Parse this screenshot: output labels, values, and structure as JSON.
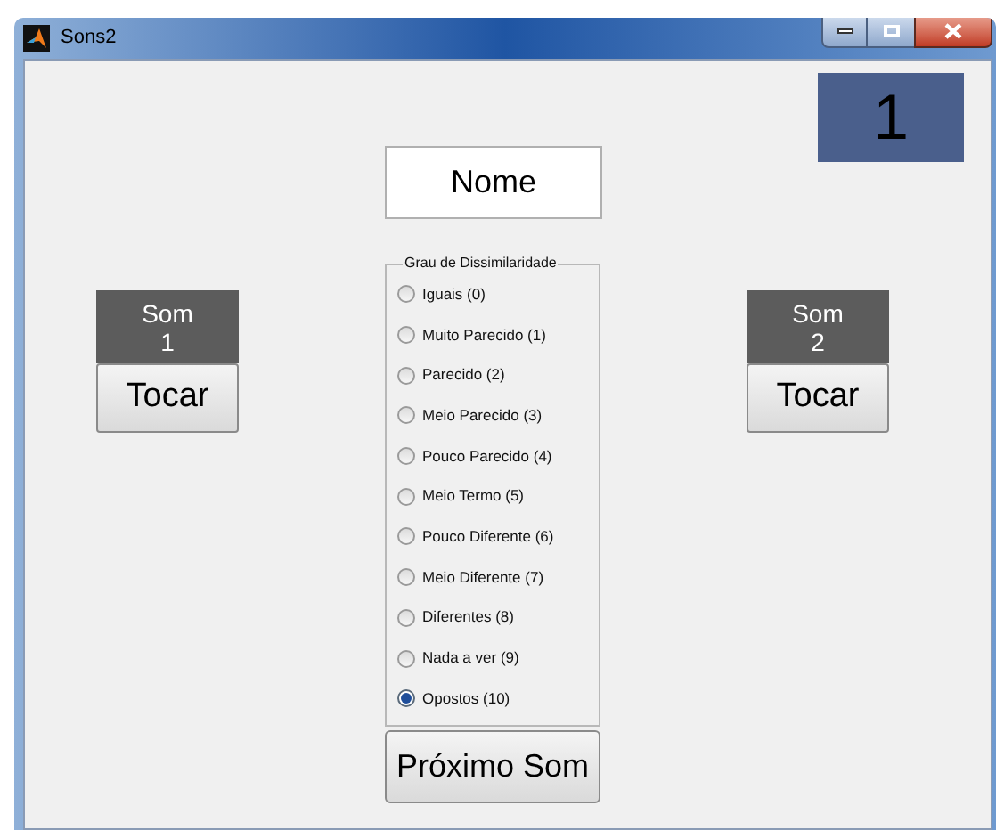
{
  "window": {
    "title": "Sons2"
  },
  "counter": "1",
  "name_field": {
    "value": "Nome"
  },
  "sounds": [
    {
      "label": "Som\n1",
      "button": "Tocar"
    },
    {
      "label": "Som\n2",
      "button": "Tocar"
    }
  ],
  "dissimilarity": {
    "title": "Grau de Dissimilaridade",
    "options": [
      {
        "label": "Iguais (0)",
        "selected": false
      },
      {
        "label": "Muito Parecido (1)",
        "selected": false
      },
      {
        "label": "Parecido (2)",
        "selected": false
      },
      {
        "label": "Meio Parecido (3)",
        "selected": false
      },
      {
        "label": "Pouco Parecido (4)",
        "selected": false
      },
      {
        "label": "Meio Termo (5)",
        "selected": false
      },
      {
        "label": "Pouco Diferente (6)",
        "selected": false
      },
      {
        "label": "Meio Diferente (7)",
        "selected": false
      },
      {
        "label": "Diferentes (8)",
        "selected": false
      },
      {
        "label": "Nada a ver (9)",
        "selected": false
      },
      {
        "label": "Opostos (10)",
        "selected": true
      }
    ]
  },
  "next_button": "Próximo Som"
}
